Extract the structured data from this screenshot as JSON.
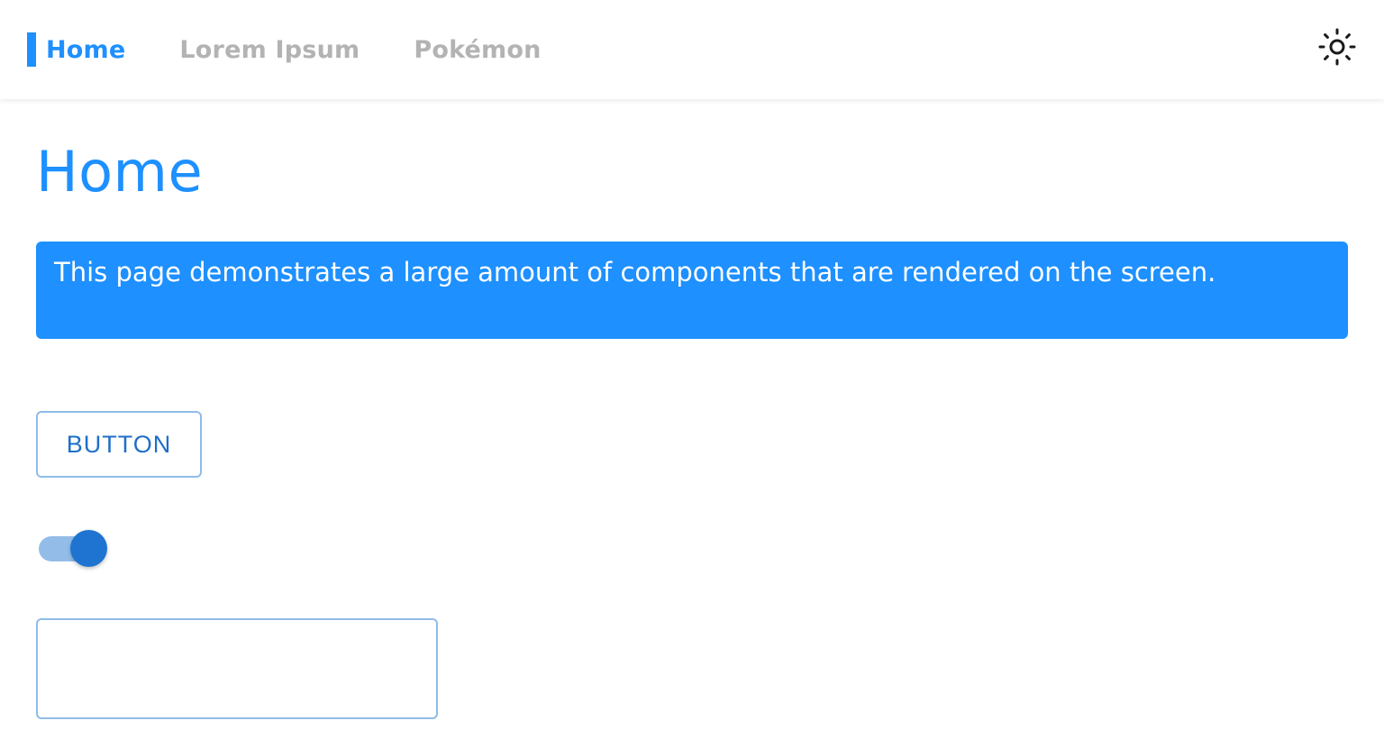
{
  "nav": {
    "items": [
      {
        "label": "Home",
        "active": true
      },
      {
        "label": "Lorem Ipsum",
        "active": false
      },
      {
        "label": "Pokémon",
        "active": false
      }
    ],
    "theme_toggle_icon": "sun-icon"
  },
  "main": {
    "title": "Home",
    "banner_text": "This page demonstrates a large amount of components that are rendered on the screen.",
    "button_label": "BUTTON",
    "switch": {
      "checked": true
    },
    "text_input": {
      "value": "",
      "placeholder": ""
    }
  },
  "colors": {
    "accent": "#1e90ff",
    "nav_inactive": "#b3b3b3",
    "button_text": "#1f6fc8",
    "outline": "#8fbce8",
    "switch_thumb": "#1f74d2",
    "switch_track": "#93bde8"
  }
}
